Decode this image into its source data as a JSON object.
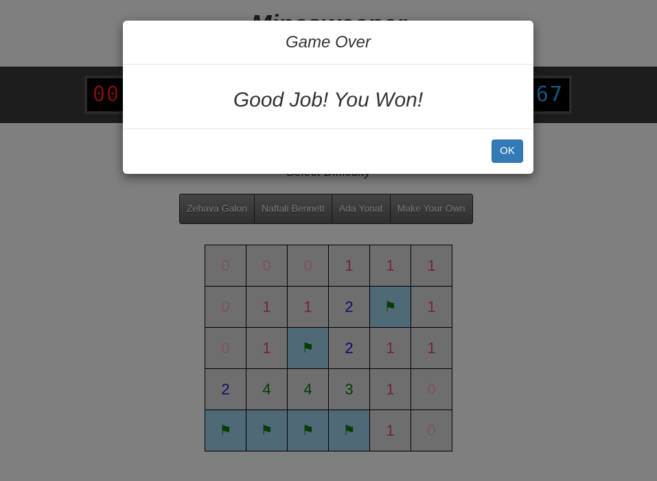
{
  "header": {
    "title": "Minesweeper"
  },
  "hud": {
    "mines_left": "00",
    "timer": "67"
  },
  "difficulty": {
    "label": "Select Difficulty",
    "options": [
      "Zehava Galon",
      "Naftali Bennett",
      "Ada Yonat",
      "Make Your Own"
    ]
  },
  "board": {
    "rows": [
      [
        "0",
        "0",
        "0",
        "1",
        "1",
        "1"
      ],
      [
        "0",
        "1",
        "1",
        "2",
        "F",
        "1"
      ],
      [
        "0",
        "1",
        "F",
        "2",
        "1",
        "1"
      ],
      [
        "2",
        "4",
        "4",
        "3",
        "1",
        "0"
      ],
      [
        "F",
        "F",
        "F",
        "F",
        "1",
        "0"
      ]
    ]
  },
  "colors": {
    "flag_cell": "#9fd2ec",
    "n0": "#f7a6c2",
    "n1": "#e0458a",
    "n2": "#1a1ae0",
    "n3": "#0d7a0d",
    "n4": "#0d7a0d"
  },
  "icons": {
    "flag": "flag-icon"
  },
  "modal": {
    "title": "Game Over",
    "message": "Good Job! You Won!",
    "ok_label": "OK"
  }
}
